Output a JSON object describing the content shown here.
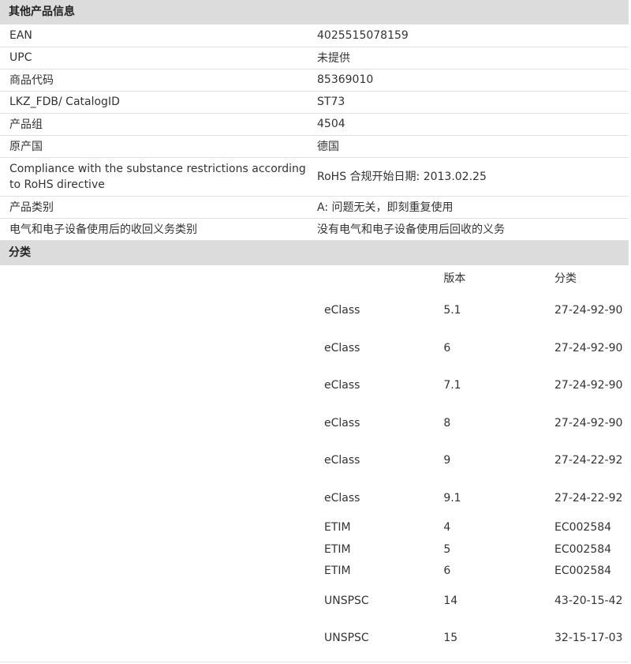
{
  "other_info": {
    "header": "其他产品信息",
    "rows": [
      {
        "key": "EAN",
        "value": "4025515078159"
      },
      {
        "key": "UPC",
        "value": "未提供"
      },
      {
        "key": "商品代码",
        "value": "85369010"
      },
      {
        "key": "LKZ_FDB/ CatalogID",
        "value": "ST73"
      },
      {
        "key": "产品组",
        "value": "4504"
      },
      {
        "key": "原产国",
        "value": "德国"
      },
      {
        "key": "Compliance with the substance restrictions according to RoHS directive",
        "value": "RoHS 合规开始日期: 2013.02.25"
      },
      {
        "key": "产品类别",
        "value": "A: 问题无关，即刻重复使用"
      },
      {
        "key": "电气和电子设备使用后的收回义务类别",
        "value": "没有电气和电子设备使用后回收的义务"
      }
    ]
  },
  "classification": {
    "header": "分类",
    "columns": [
      "",
      "版本",
      "分类"
    ],
    "rows": [
      {
        "system": "eClass",
        "version": "5.1",
        "code": "27-24-92-90"
      },
      {
        "system": "eClass",
        "version": "6",
        "code": "27-24-92-90"
      },
      {
        "system": "eClass",
        "version": "7.1",
        "code": "27-24-92-90"
      },
      {
        "system": "eClass",
        "version": "8",
        "code": "27-24-92-90"
      },
      {
        "system": "eClass",
        "version": "9",
        "code": "27-24-22-92"
      },
      {
        "system": "eClass",
        "version": "9.1",
        "code": "27-24-22-92"
      },
      {
        "system": "ETIM",
        "version": "4",
        "code": "EC002584"
      },
      {
        "system": "ETIM",
        "version": "5",
        "code": "EC002584"
      },
      {
        "system": "ETIM",
        "version": "6",
        "code": "EC002584"
      },
      {
        "system": "UNSPSC",
        "version": "14",
        "code": "43-20-15-42"
      },
      {
        "system": "UNSPSC",
        "version": "15",
        "code": "32-15-17-03"
      }
    ]
  }
}
